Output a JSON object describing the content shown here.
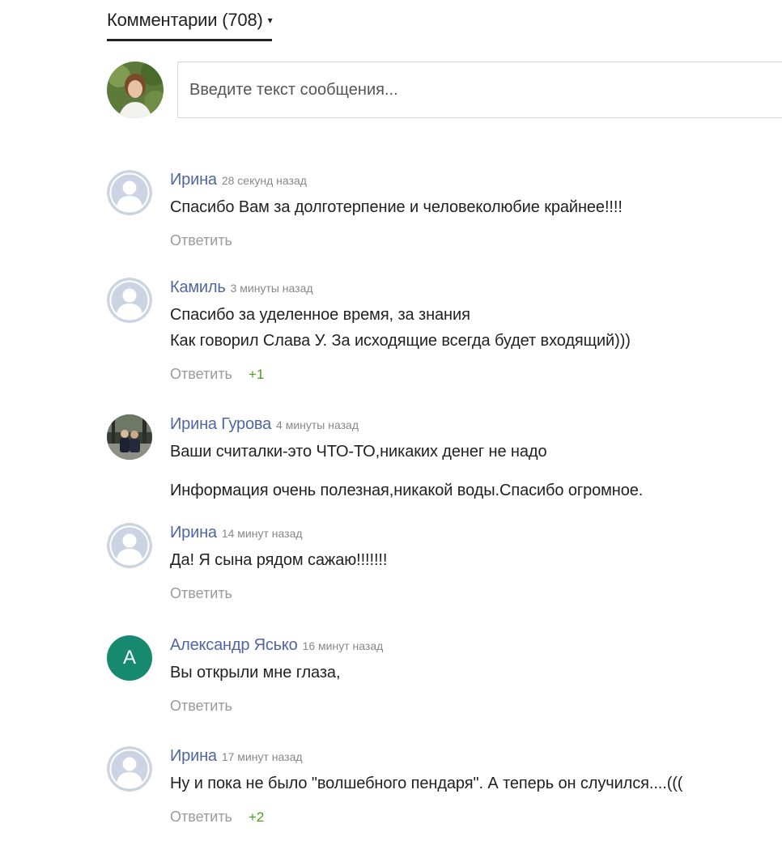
{
  "header": {
    "title": "Комментарии (708)",
    "caret": "▾"
  },
  "composer": {
    "placeholder": "Введите текст сообщения..."
  },
  "reply_label": "Ответить",
  "accent_colors": {
    "author": "#5066a3",
    "likes": "#4f9a1e",
    "letter_avatar_bg": "#16896f"
  },
  "comments": [
    {
      "author": "Ирина",
      "time": "28 секунд назад",
      "avatar": "default-avatar",
      "lines": [
        "Спасибо Вам за долготерпение и человеколюбие крайнее!!!!"
      ],
      "likes": ""
    },
    {
      "author": "Камиль",
      "time": "3 минуты назад",
      "avatar": "default-avatar",
      "lines": [
        "Спасибо за уделенное время, за знания",
        "Как говорил Слава У. За исходящие всегда будет входящий)))"
      ],
      "likes": "+1"
    },
    {
      "author": "Ирина Гурова",
      "time": "4 минуты назад",
      "avatar": "photo-avatar",
      "lines": [
        "Ваши считалки-это ЧТО-ТО,никаких денег не надо",
        "Информация очень полезная,никакой воды.Спасибо огромное."
      ],
      "likes": ""
    },
    {
      "author": "Ирина",
      "time": "14 минут назад",
      "avatar": "default-avatar",
      "lines": [
        "Да! Я сына рядом сажаю!!!!!!!"
      ],
      "likes": ""
    },
    {
      "author": "Александр Ясько",
      "time": "16 минут назад",
      "avatar": "letter-avatar",
      "letter": "А",
      "lines": [
        "Вы открыли мне глаза,"
      ],
      "likes": ""
    },
    {
      "author": "Ирина",
      "time": "17 минут назад",
      "avatar": "default-avatar",
      "lines": [
        "Ну и пока не было \"волшебного пендаря\". А теперь он случился....((("
      ],
      "likes": "+2"
    }
  ]
}
